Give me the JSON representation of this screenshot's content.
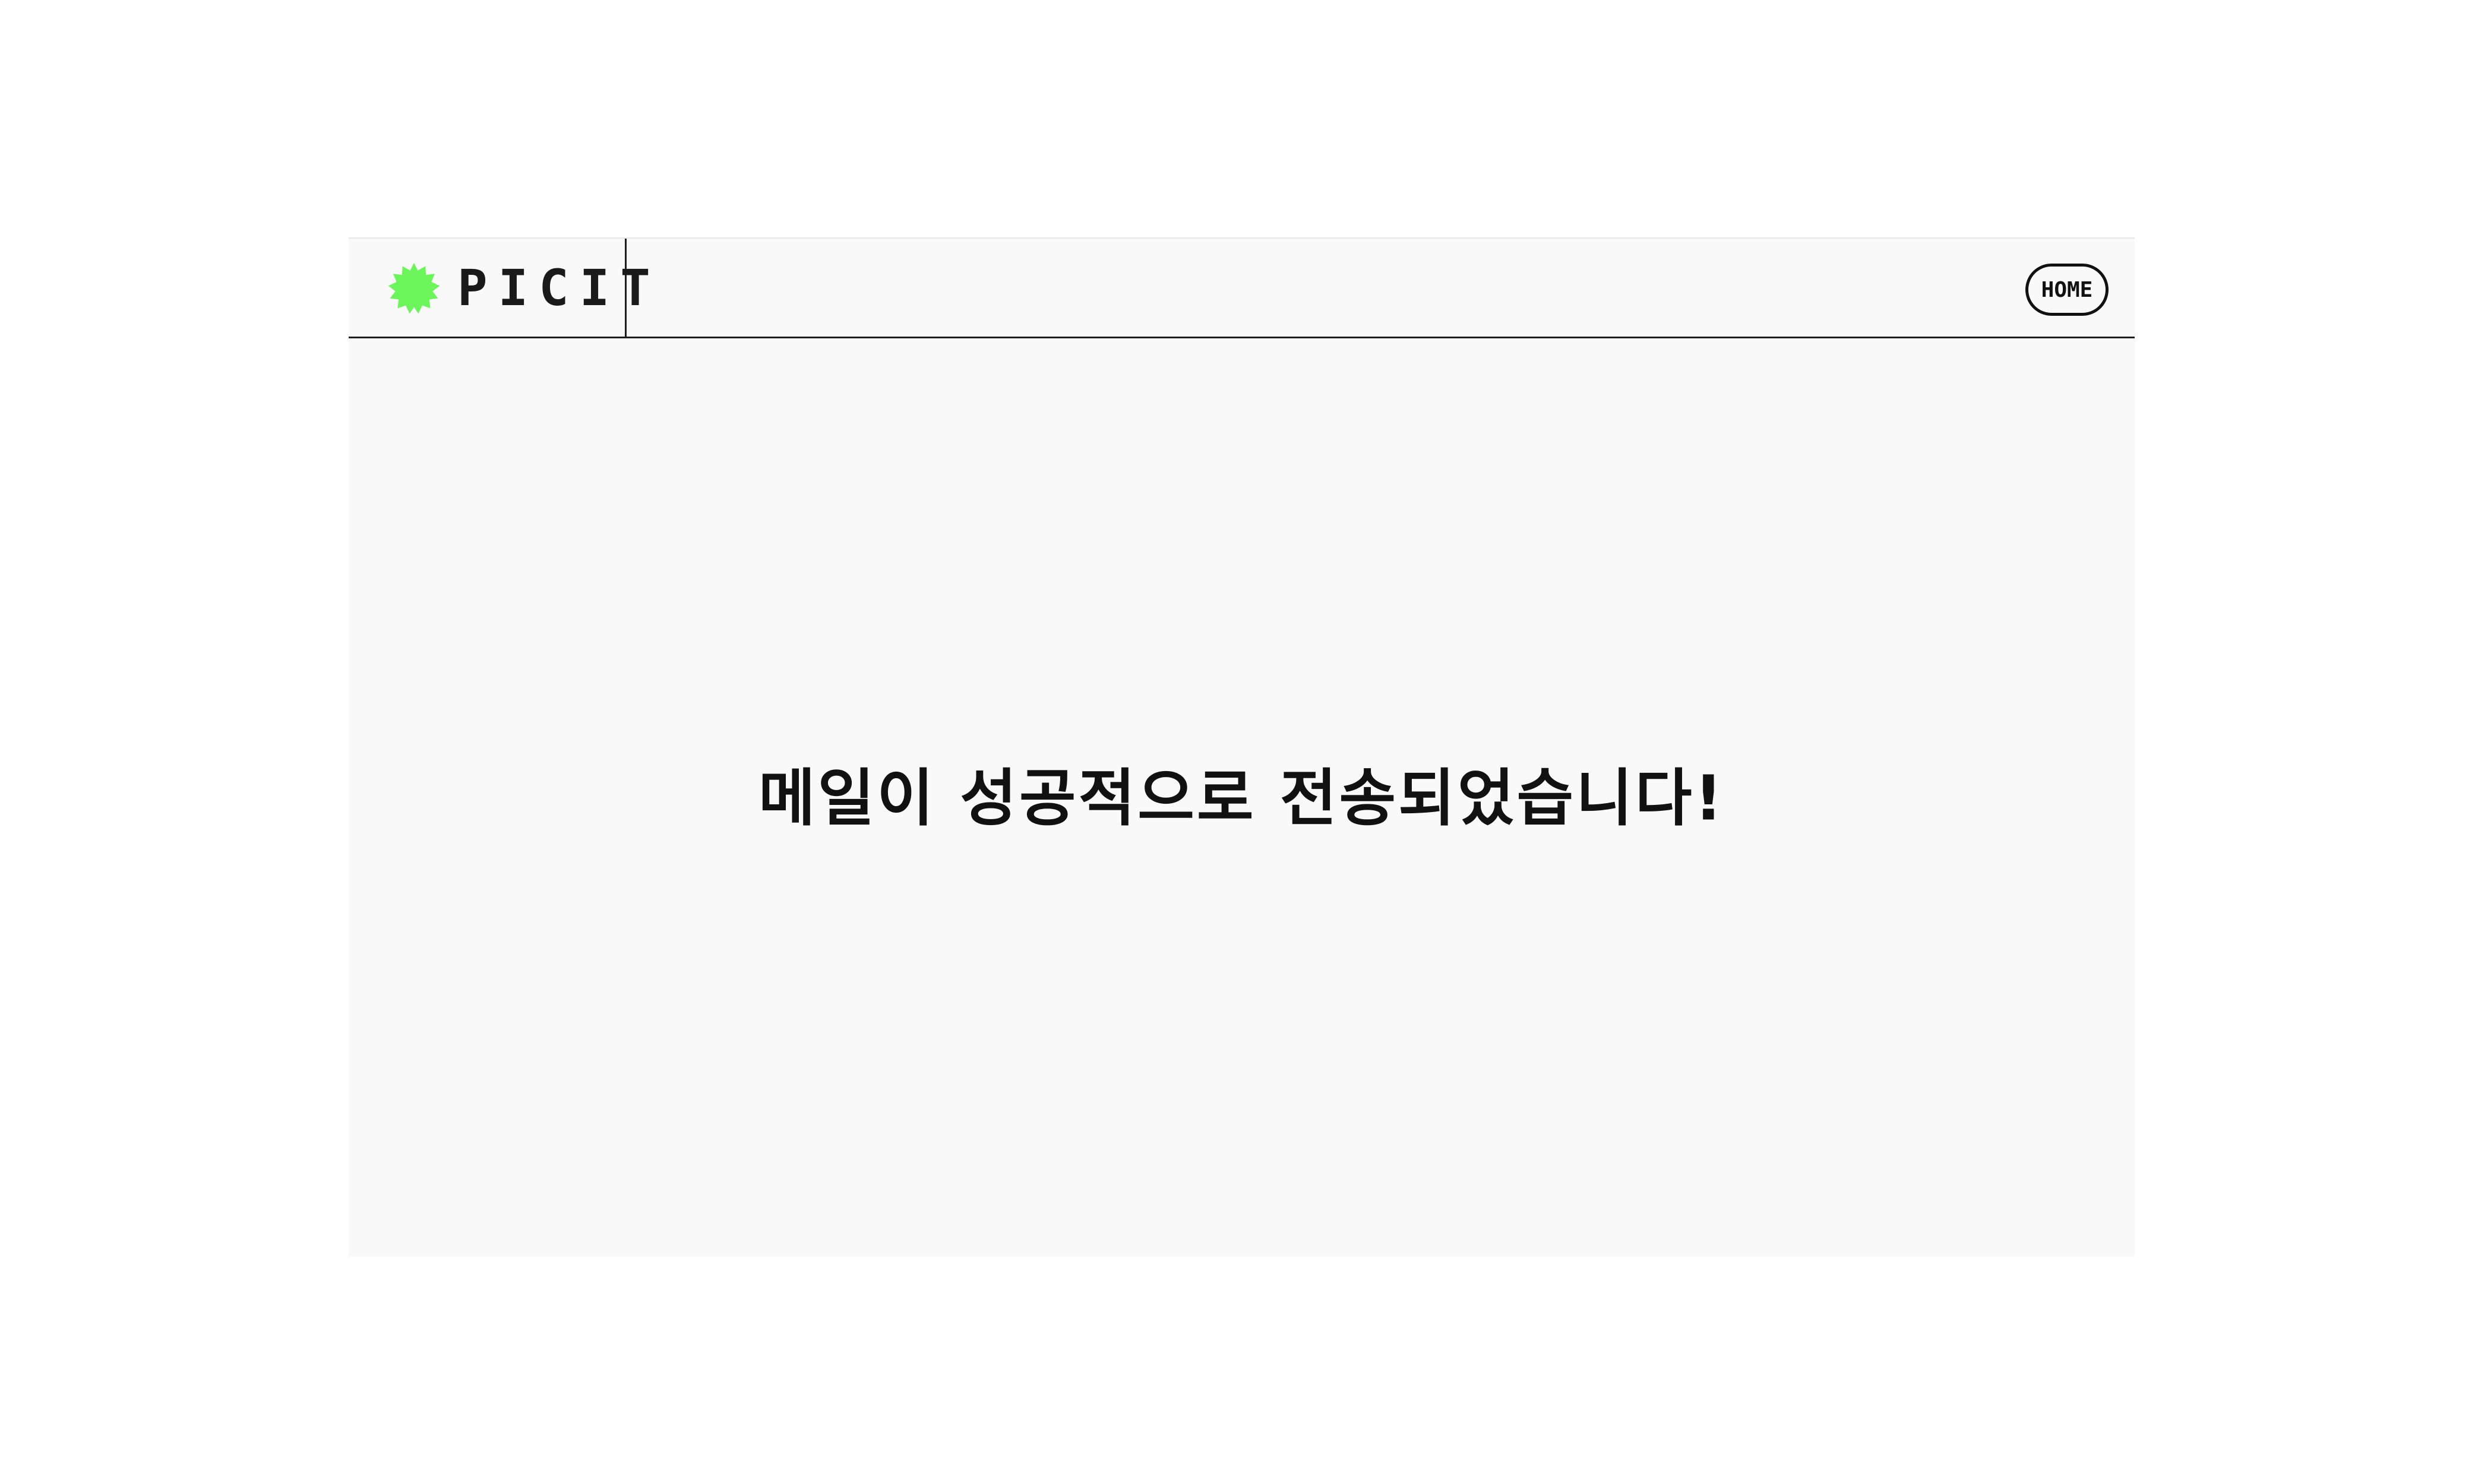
{
  "header": {
    "brand_name": "PICIT",
    "brand_logo_icon": "green-star-badge-icon",
    "brand_logo_color": "#6bf55a",
    "home_label": "HOME"
  },
  "main": {
    "message": "메일이 성공적으로 전송되었습니다!"
  }
}
